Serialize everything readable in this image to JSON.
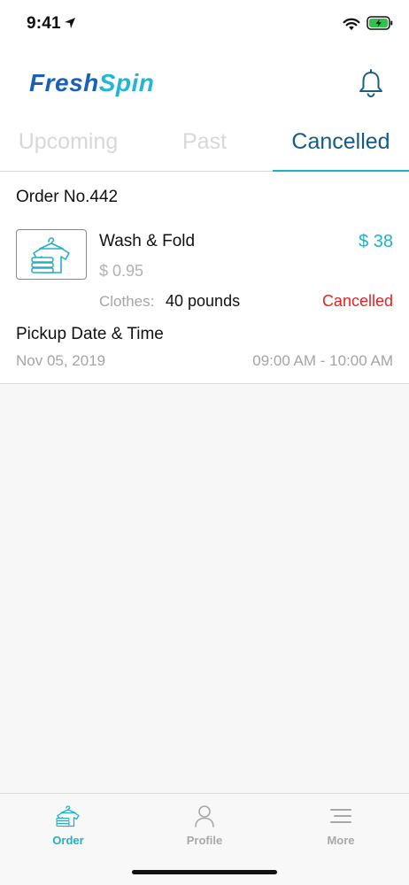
{
  "status_bar": {
    "time": "9:41"
  },
  "header": {
    "logo_part1": "Fresh",
    "logo_part2": "Spin",
    "bell_icon": "bell-icon"
  },
  "tabs": [
    {
      "label": "Upcoming",
      "active": false
    },
    {
      "label": "Past",
      "active": false
    },
    {
      "label": "Cancelled",
      "active": true
    }
  ],
  "order": {
    "number": "Order No.442",
    "service_icon": "laundry-shirt-icon",
    "service_name": "Wash & Fold",
    "total": "$ 38",
    "unit_price": "$ 0.95",
    "clothes_label": "Clothes:",
    "clothes_value": "40 pounds",
    "status": "Cancelled",
    "pickup_title": "Pickup Date & Time",
    "pickup_date": "Nov 05, 2019",
    "pickup_time": "09:00 AM - 10:00 AM"
  },
  "tab_bar": [
    {
      "label": "Order",
      "icon": "order-shirt-icon",
      "active": true
    },
    {
      "label": "Profile",
      "icon": "person-icon",
      "active": false
    },
    {
      "label": "More",
      "icon": "menu-lines-icon",
      "active": false
    }
  ],
  "colors": {
    "accent": "#22b0c4",
    "brand_dark": "#135b8a",
    "logo_blue": "#1b5fb8",
    "cancelled_red": "#e52222"
  }
}
